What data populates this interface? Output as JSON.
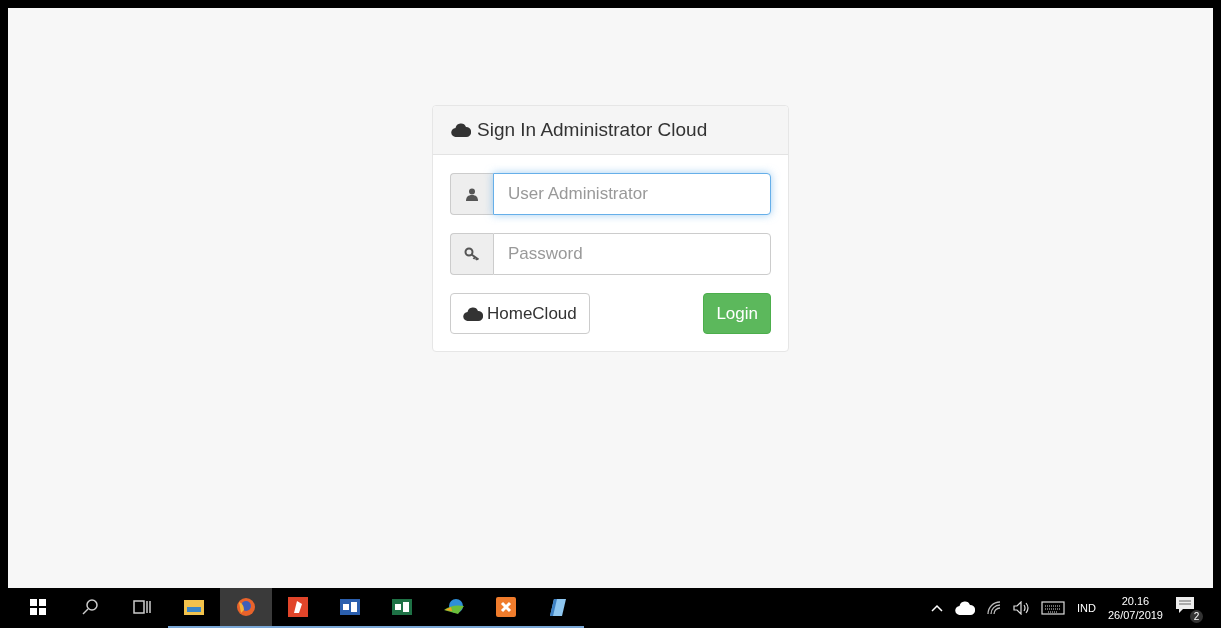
{
  "panel": {
    "title": "Sign In Administrator Cloud",
    "fields": [
      {
        "kind": "user",
        "placeholder": "User Administrator",
        "focused": true
      },
      {
        "kind": "key",
        "placeholder": "Password",
        "focused": false
      }
    ],
    "buttons": [
      {
        "kind": "default",
        "label": "HomeCloud"
      },
      {
        "kind": "primary",
        "label": "Login"
      }
    ]
  },
  "taskbar": {
    "apps": [
      {
        "kind": "folder",
        "selected": false
      },
      {
        "kind": "browser",
        "selected": true
      },
      {
        "kind": "pdf",
        "selected": false
      },
      {
        "kind": "word",
        "selected": false
      },
      {
        "kind": "excel",
        "selected": false
      },
      {
        "kind": "globe",
        "selected": false
      },
      {
        "kind": "xampp",
        "selected": false
      },
      {
        "kind": "notes",
        "selected": false
      }
    ],
    "language": "IND",
    "time": "20.16",
    "date": "26/07/2019",
    "notifications": "2"
  }
}
